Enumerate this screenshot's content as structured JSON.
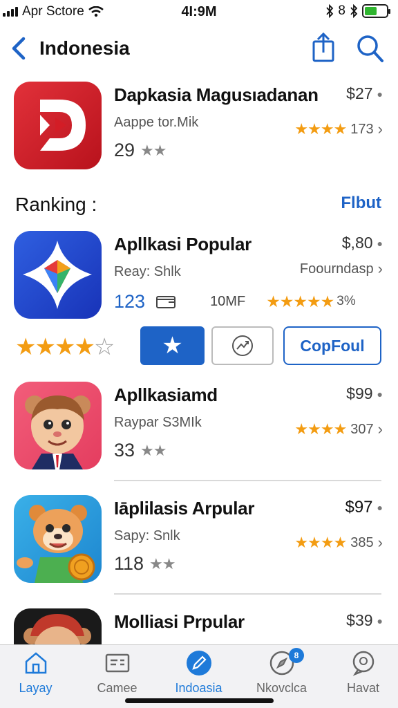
{
  "status": {
    "carrier": "Apr Sctore",
    "time": "4I:9M",
    "right_text": "8"
  },
  "nav": {
    "title": "Indonesia",
    "accent": "#1e63c6"
  },
  "featured": {
    "name": "Dapkasia Magusıadanan",
    "price": "$27",
    "subtitle": "Aappe tor.Mik",
    "stars": "★★★★",
    "count": "173",
    "stat": "29",
    "gray_stars": "★★"
  },
  "section": {
    "title": "Ranking :",
    "link": "Flbut"
  },
  "popular": {
    "name": "Apllkasi Popular",
    "price": "$,80",
    "subtitle": "Reay: Shlk",
    "right_text": "Foourndasp",
    "num": "123",
    "size": "10MF",
    "stars": "★★★★★",
    "pct": "3%"
  },
  "actions": {
    "rating_full": "★★★★",
    "rating_empty": "☆",
    "star_button": "★",
    "cop_button": "CopFoul"
  },
  "apps": [
    {
      "name": "Apllkasiamd",
      "price": "$99",
      "subtitle": "Raypar S3MIk",
      "stars": "★★★★",
      "count": "307",
      "stat": "33",
      "gray_stars": "★★"
    },
    {
      "name": "Iāplilasis Arpular",
      "price": "$97",
      "subtitle": "Sapy: Snlk",
      "stars": "★★★★",
      "count": "385",
      "stat": "118",
      "gray_stars": "★★"
    },
    {
      "name": "Molliasi Prpular",
      "price": "$39"
    }
  ],
  "tabs": [
    {
      "label": "Layay"
    },
    {
      "label": "Camee"
    },
    {
      "label": "Indoasia"
    },
    {
      "label": "Nkovclca",
      "badge": "8"
    },
    {
      "label": "Havat"
    }
  ]
}
